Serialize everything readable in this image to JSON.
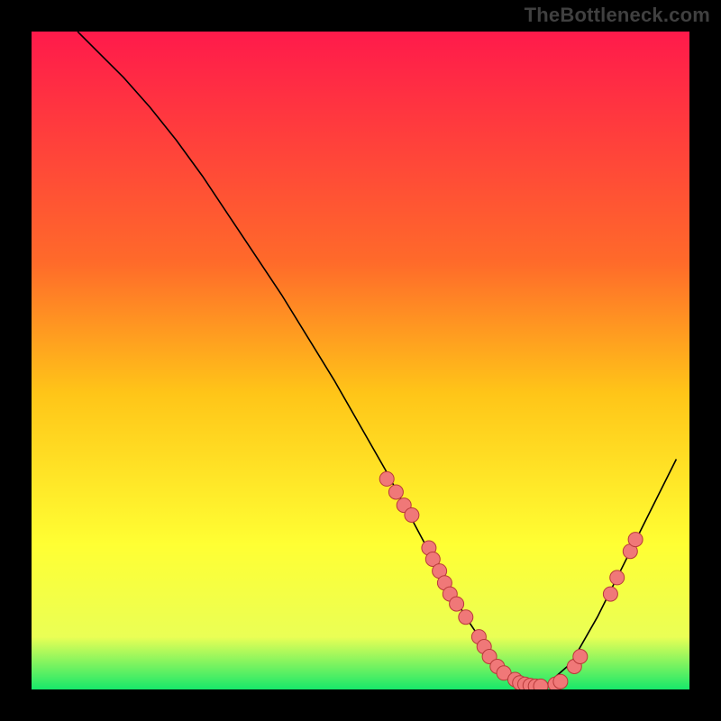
{
  "watermark": "TheBottleneck.com",
  "chart_data": {
    "type": "line",
    "title": "",
    "xlabel": "",
    "ylabel": "",
    "xlim": [
      0,
      100
    ],
    "ylim": [
      0,
      100
    ],
    "gradient_stops": [
      {
        "offset": 0,
        "color": "#ff1a4b"
      },
      {
        "offset": 35,
        "color": "#ff6a2a"
      },
      {
        "offset": 55,
        "color": "#ffc518"
      },
      {
        "offset": 78,
        "color": "#ffff33"
      },
      {
        "offset": 92,
        "color": "#eaff55"
      },
      {
        "offset": 100,
        "color": "#17e86a"
      }
    ],
    "series": [
      {
        "name": "bottleneck-curve",
        "x": [
          7,
          10,
          14,
          18,
          22,
          26,
          30,
          34,
          38,
          42,
          46,
          50,
          54,
          58,
          62,
          66,
          70,
          74,
          78,
          82,
          86,
          90,
          94,
          98
        ],
        "y": [
          100,
          97,
          93,
          88.5,
          83.5,
          78,
          72,
          66,
          60,
          53.5,
          47,
          40,
          33,
          25.5,
          18,
          11,
          5,
          1.5,
          0.5,
          4,
          11,
          19,
          27,
          35
        ]
      }
    ],
    "dot_clusters": [
      {
        "name": "descent-cluster",
        "points": [
          {
            "x": 54.0,
            "y": 32
          },
          {
            "x": 55.4,
            "y": 30
          },
          {
            "x": 56.6,
            "y": 28
          },
          {
            "x": 57.8,
            "y": 26.5
          },
          {
            "x": 60.4,
            "y": 21.5
          },
          {
            "x": 61.0,
            "y": 19.8
          },
          {
            "x": 62.0,
            "y": 18
          },
          {
            "x": 62.8,
            "y": 16.2
          },
          {
            "x": 63.6,
            "y": 14.5
          },
          {
            "x": 64.6,
            "y": 13
          },
          {
            "x": 66.0,
            "y": 11
          },
          {
            "x": 68.0,
            "y": 8
          },
          {
            "x": 68.8,
            "y": 6.5
          },
          {
            "x": 69.6,
            "y": 5
          },
          {
            "x": 70.8,
            "y": 3.5
          },
          {
            "x": 71.8,
            "y": 2.5
          }
        ]
      },
      {
        "name": "valley-cluster",
        "points": [
          {
            "x": 73.5,
            "y": 1.5
          },
          {
            "x": 74.2,
            "y": 1.0
          },
          {
            "x": 75.0,
            "y": 0.8
          },
          {
            "x": 75.8,
            "y": 0.6
          },
          {
            "x": 76.6,
            "y": 0.5
          },
          {
            "x": 77.4,
            "y": 0.5
          },
          {
            "x": 79.6,
            "y": 0.8
          },
          {
            "x": 80.4,
            "y": 1.2
          },
          {
            "x": 82.5,
            "y": 3.5
          },
          {
            "x": 83.4,
            "y": 5.0
          }
        ]
      },
      {
        "name": "ascent-cluster",
        "points": [
          {
            "x": 88.0,
            "y": 14.5
          },
          {
            "x": 89.0,
            "y": 17.0
          },
          {
            "x": 91.0,
            "y": 21.0
          },
          {
            "x": 91.8,
            "y": 22.8
          }
        ]
      }
    ],
    "markers": {
      "fill": "#f07878",
      "stroke": "#b93a3a",
      "radius": 8
    },
    "line": {
      "color": "#000000",
      "width": 1.6
    }
  }
}
